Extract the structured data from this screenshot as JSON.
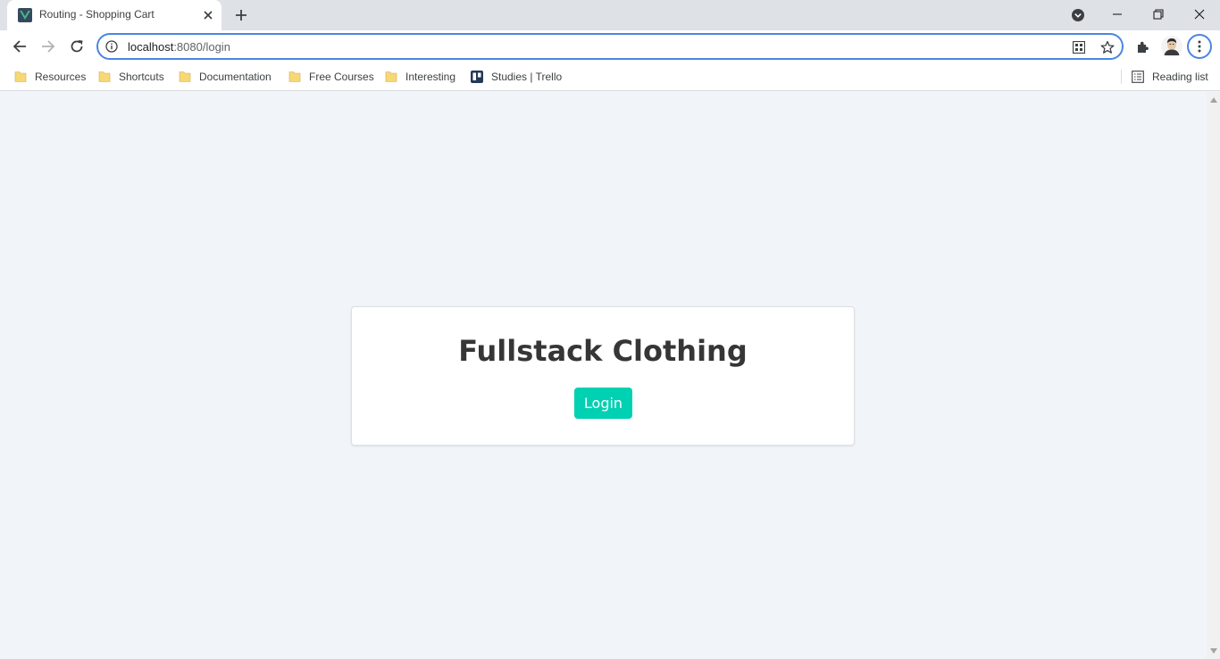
{
  "browser": {
    "tab": {
      "title": "Routing - Shopping Cart",
      "favicon": "vue-logo-icon"
    },
    "address_bar": {
      "host": "localhost",
      "path": ":8080/login"
    },
    "bookmarks": [
      {
        "label": "Resources",
        "icon": "folder-icon"
      },
      {
        "label": "Shortcuts",
        "icon": "folder-icon"
      },
      {
        "label": "Documentation",
        "icon": "folder-icon"
      },
      {
        "label": "Free Courses",
        "icon": "folder-icon"
      },
      {
        "label": "Interesting",
        "icon": "folder-icon"
      },
      {
        "label": "Studies | Trello",
        "icon": "trello-icon"
      }
    ],
    "reading_list_label": "Reading list",
    "colors": {
      "tabstrip": "#dee1e6",
      "focus_ring": "#4a86e0",
      "folder": "#f8d775"
    }
  },
  "page": {
    "title": "Fullstack Clothing",
    "login_button": "Login",
    "colors": {
      "background": "#f1f4f8",
      "primary": "#00d1b2",
      "title": "#363636"
    }
  }
}
